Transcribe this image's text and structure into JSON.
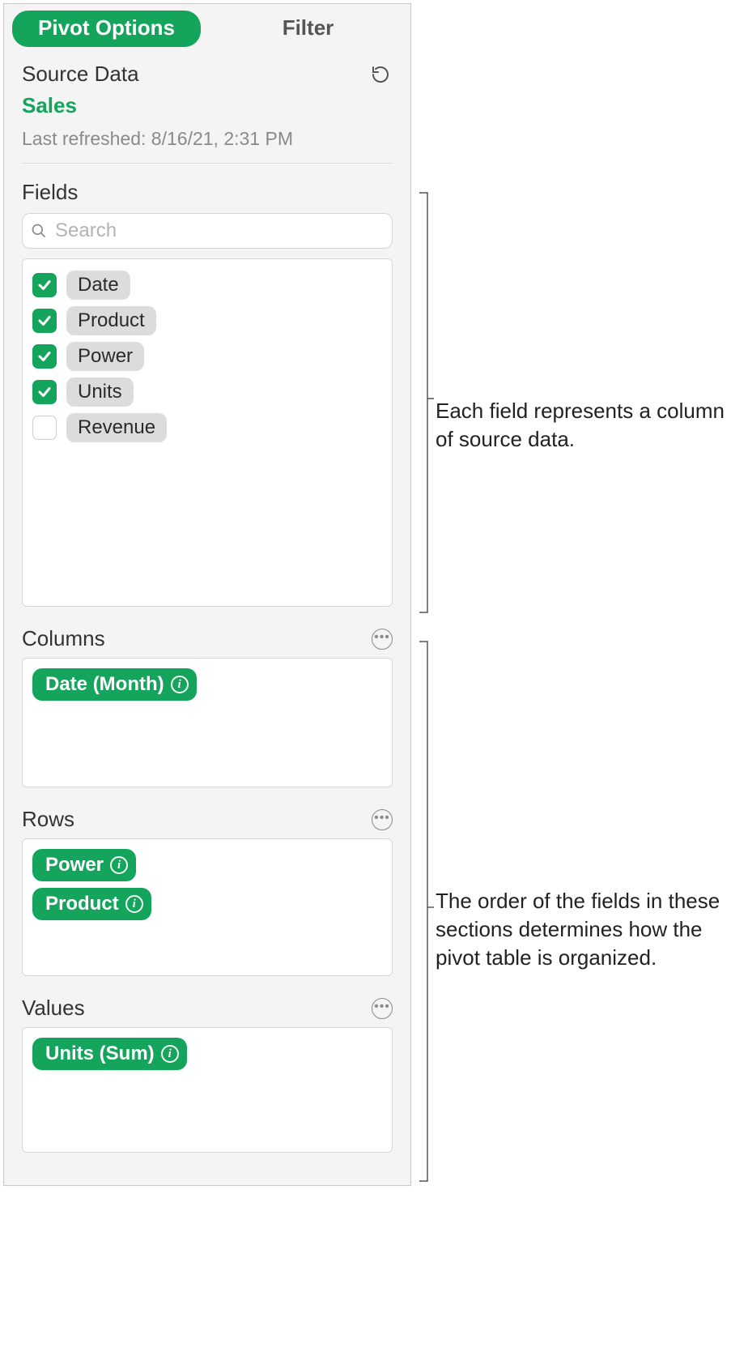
{
  "tabs": {
    "pivot_options": "Pivot Options",
    "filter": "Filter"
  },
  "source": {
    "header": "Source Data",
    "name": "Sales",
    "last_refreshed": "Last refreshed: 8/16/21, 2:31 PM"
  },
  "fields": {
    "header": "Fields",
    "search_placeholder": "Search",
    "items": [
      {
        "label": "Date",
        "checked": true
      },
      {
        "label": "Product",
        "checked": true
      },
      {
        "label": "Power",
        "checked": true
      },
      {
        "label": "Units",
        "checked": true
      },
      {
        "label": "Revenue",
        "checked": false
      }
    ]
  },
  "columns": {
    "header": "Columns",
    "items": [
      "Date (Month)"
    ]
  },
  "rows": {
    "header": "Rows",
    "items": [
      "Power",
      "Product"
    ]
  },
  "values": {
    "header": "Values",
    "items": [
      "Units (Sum)"
    ]
  },
  "callouts": {
    "fields": "Each field represents a column of source data.",
    "order": "The order of the fields in these sections determines how the pivot table is organized."
  }
}
